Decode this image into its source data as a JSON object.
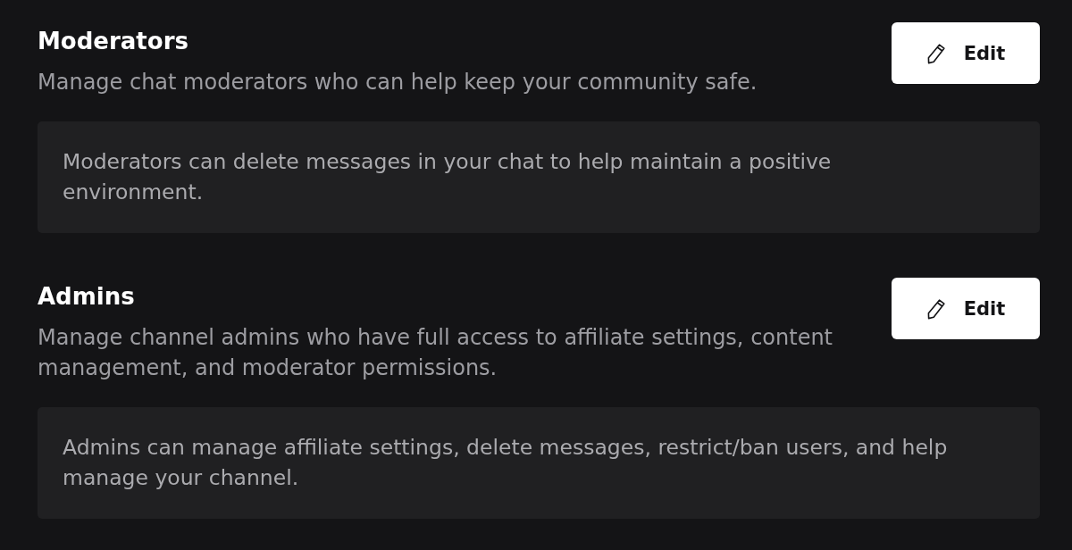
{
  "sections": [
    {
      "title": "Moderators",
      "description": "Manage chat moderators who can help keep your community safe.",
      "button": {
        "label": "Edit"
      },
      "note": "Moderators can delete messages in your chat to help maintain a positive environment."
    },
    {
      "title": "Admins",
      "description": "Manage channel admins who have full access to affiliate settings, content management, and moderator permissions.",
      "button": {
        "label": "Edit"
      },
      "note": "Admins can manage affiliate settings, delete messages, restrict/ban users, and help manage your channel."
    }
  ]
}
